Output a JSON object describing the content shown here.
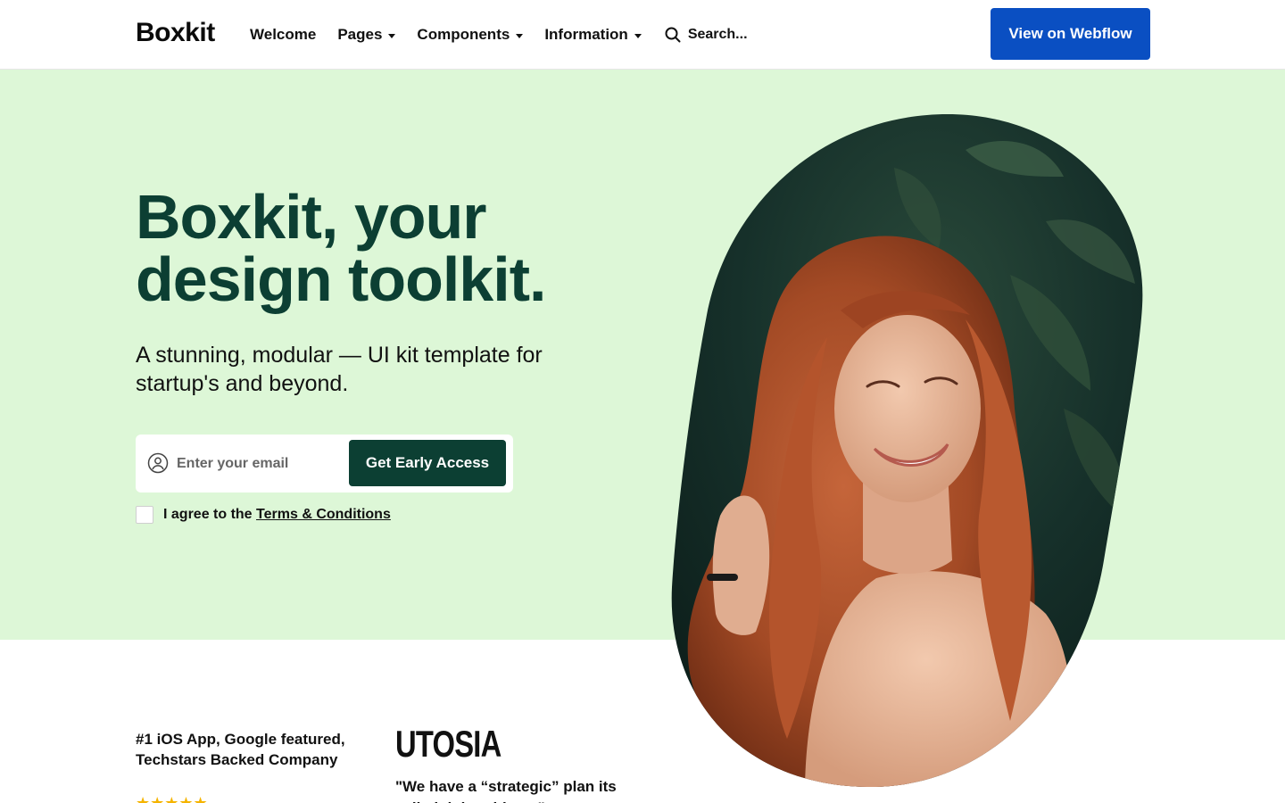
{
  "header": {
    "logo": "Boxkit",
    "nav": [
      {
        "label": "Welcome",
        "has_dropdown": false
      },
      {
        "label": "Pages",
        "has_dropdown": true
      },
      {
        "label": "Components",
        "has_dropdown": true
      },
      {
        "label": "Information",
        "has_dropdown": true
      }
    ],
    "search_label": "Search...",
    "search_icon": "search-icon",
    "cta_label": "View on Webflow"
  },
  "hero": {
    "headline_line1": "Boxkit, your",
    "headline_line2": "design toolkit.",
    "subhead": "A stunning, modular — UI kit template for startup's and beyond.",
    "email_placeholder": "Enter your email",
    "email_icon": "user-circle-icon",
    "cta_label": "Get Early Access",
    "agree_text": "I agree to the ",
    "terms_link": "Terms & Conditions",
    "image_alt": "Smiling woman with long curly red hair in front of green foliage"
  },
  "social_proof": {
    "featured_text": "#1 iOS App, Google featured, Techstars Backed Company",
    "stars": "★★★★★",
    "brand": "UTOSIA",
    "quote": "\"We have a “strategic” plan its called doing things.\""
  },
  "colors": {
    "hero_bg": "#ddf7d7",
    "headline": "#0c3f33",
    "primary_dark": "#0c3f33",
    "brand_blue": "#0a4fc2",
    "star": "#f5b400"
  }
}
